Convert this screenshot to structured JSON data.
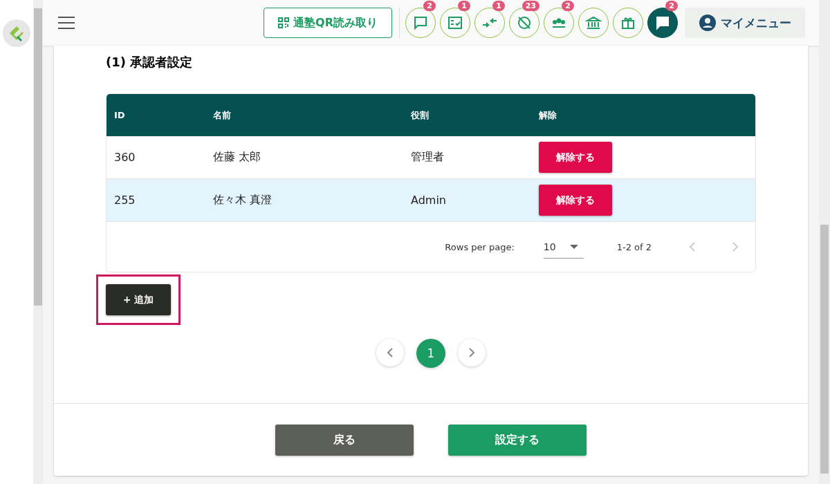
{
  "header": {
    "qr_button": "通塾QR読み取り",
    "icons": [
      {
        "kind": "chat",
        "badge": "2",
        "active": false
      },
      {
        "kind": "checklist",
        "badge": "1",
        "active": false
      },
      {
        "kind": "arrows",
        "badge": "1",
        "active": false
      },
      {
        "kind": "blocked",
        "badge": "23",
        "active": false
      },
      {
        "kind": "group",
        "badge": "2",
        "active": false
      },
      {
        "kind": "bank",
        "active": false
      },
      {
        "kind": "gift",
        "active": false
      },
      {
        "kind": "chat",
        "badge": "2",
        "active": true
      }
    ],
    "my_menu": "マイメニュー"
  },
  "section_title": "(1) 承認者設定",
  "table": {
    "columns": [
      "ID",
      "名前",
      "役割",
      "解除"
    ],
    "rows": [
      {
        "id": "360",
        "name": "佐藤 太郎",
        "role": "管理者",
        "action": "解除する",
        "selected": false
      },
      {
        "id": "255",
        "name": "佐々木 真澄",
        "role": "Admin",
        "action": "解除する",
        "selected": true
      }
    ],
    "footer": {
      "rows_label": "Rows per page:",
      "rows_value": "10",
      "range": "1-2 of 2"
    }
  },
  "add_button": {
    "label": "+ 追加",
    "highlighted": true
  },
  "pagination": [
    {
      "label": "1",
      "selected": true
    }
  ],
  "buttons": {
    "back": "戻る",
    "submit": "設定する"
  }
}
